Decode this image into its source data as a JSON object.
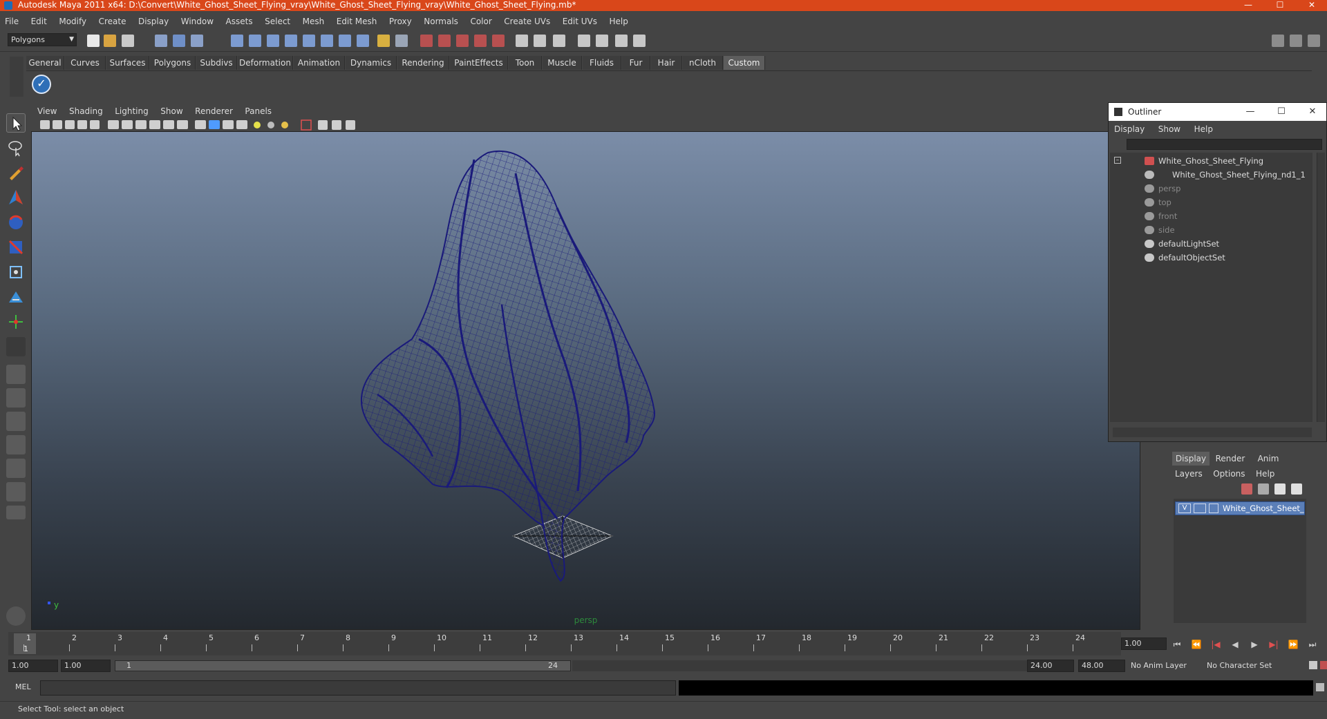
{
  "window": {
    "title": "Autodesk Maya 2011 x64: D:\\Convert\\White_Ghost_Sheet_Flying_vray\\White_Ghost_Sheet_Flying_vray\\White_Ghost_Sheet_Flying.mb*",
    "minimize": "—",
    "maximize": "☐",
    "close": "✕"
  },
  "menubar": [
    "File",
    "Edit",
    "Modify",
    "Create",
    "Display",
    "Window",
    "Assets",
    "Select",
    "Mesh",
    "Edit Mesh",
    "Proxy",
    "Normals",
    "Color",
    "Create UVs",
    "Edit UVs",
    "Help"
  ],
  "statusline": {
    "mode": "Polygons"
  },
  "shelf": {
    "tabs": [
      "General",
      "Curves",
      "Surfaces",
      "Polygons",
      "Subdivs",
      "Deformation",
      "Animation",
      "Dynamics",
      "Rendering",
      "PaintEffects",
      "Toon",
      "Muscle",
      "Fluids",
      "Fur",
      "Hair",
      "nCloth",
      "Custom"
    ],
    "active": "Custom"
  },
  "viewport": {
    "menu": [
      "View",
      "Shading",
      "Lighting",
      "Show",
      "Renderer",
      "Panels"
    ],
    "camera": "persp",
    "axis_y": "y",
    "wire_color": "#1a1a7a"
  },
  "outliner": {
    "title": "Outliner",
    "menu": [
      "Display",
      "Show",
      "Help"
    ],
    "nodes": [
      {
        "label": "White_Ghost_Sheet_Flying",
        "dim": false
      },
      {
        "label": "White_Ghost_Sheet_Flying_nd1_1",
        "dim": false
      },
      {
        "label": "persp",
        "dim": true
      },
      {
        "label": "top",
        "dim": true
      },
      {
        "label": "front",
        "dim": true
      },
      {
        "label": "side",
        "dim": true
      },
      {
        "label": "defaultLightSet",
        "dim": false
      },
      {
        "label": "defaultObjectSet",
        "dim": false
      }
    ]
  },
  "layer_editor": {
    "tabs": [
      "Display",
      "Render",
      "Anim"
    ],
    "active_tab": "Display",
    "menu": [
      "Layers",
      "Options",
      "Help"
    ],
    "layer": {
      "visible": "V",
      "name": "White_Ghost_Sheet_Flying"
    }
  },
  "timeline": {
    "ticks": [
      "1",
      "2",
      "3",
      "4",
      "5",
      "6",
      "7",
      "8",
      "9",
      "10",
      "11",
      "12",
      "13",
      "14",
      "15",
      "16",
      "17",
      "18",
      "19",
      "20",
      "21",
      "22",
      "23",
      "24"
    ],
    "current": "1",
    "current_frame": "1.00"
  },
  "playback": [
    "⏮",
    "⏪",
    "|◀",
    "◀",
    "▶",
    "▶|",
    "⏩",
    "⏭"
  ],
  "range": {
    "start_time": "1.00",
    "playback_start": "1.00",
    "range_start": "1",
    "range_end": "24",
    "playback_end": "24.00",
    "end_time": "48.00",
    "anim_layer": "No Anim Layer",
    "character_set": "No Character Set"
  },
  "command": {
    "label": "MEL"
  },
  "help": {
    "text": "Select Tool: select an object"
  }
}
